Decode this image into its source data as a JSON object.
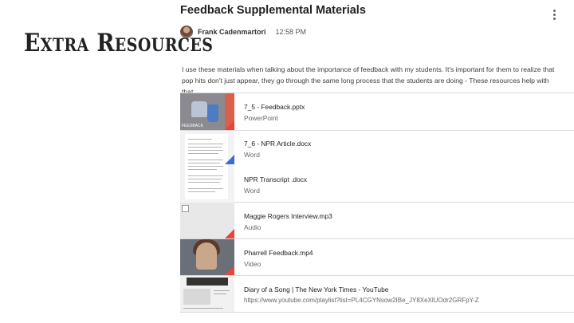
{
  "slide": {
    "title": "Extra Resources"
  },
  "post": {
    "title": "Feedback Supplemental Materials",
    "author": "Frank Cadenmartori",
    "time": "12:58 PM",
    "body": "I use these materials when talking about the importance of feedback with my students. It's important for them to realize that pop hits don't just appear, they go through the same long process that the students are doing - These resources help with that."
  },
  "attachments": [
    {
      "name": "7_5 - Feedback.pptx",
      "type": "PowerPoint",
      "icon": "pptx-thumbnail"
    },
    {
      "name": "7_6 - NPR Article.docx",
      "type": "Word",
      "icon": "docx-thumbnail"
    },
    {
      "name": "NPR Transcript .docx",
      "type": "Word",
      "icon": "docx-thumbnail"
    },
    {
      "name": "Maggie Rogers Interview.mp3",
      "type": "Audio",
      "icon": "broken-image-icon"
    },
    {
      "name": "Pharrell Feedback.mp4",
      "type": "Video",
      "icon": "video-thumbnail"
    },
    {
      "name": "Diary of a Song | The New York Times - YouTube",
      "type": "https://www.youtube.com/playlist?list=PL4CGYNsow2IBe_JY8XeXlUOdr2GRFpY-Z",
      "icon": "youtube-thumbnail"
    }
  ],
  "colors": {
    "word_blue": "#3a6bd8",
    "red_corner": "#e8453c",
    "divider": "#dadada"
  }
}
